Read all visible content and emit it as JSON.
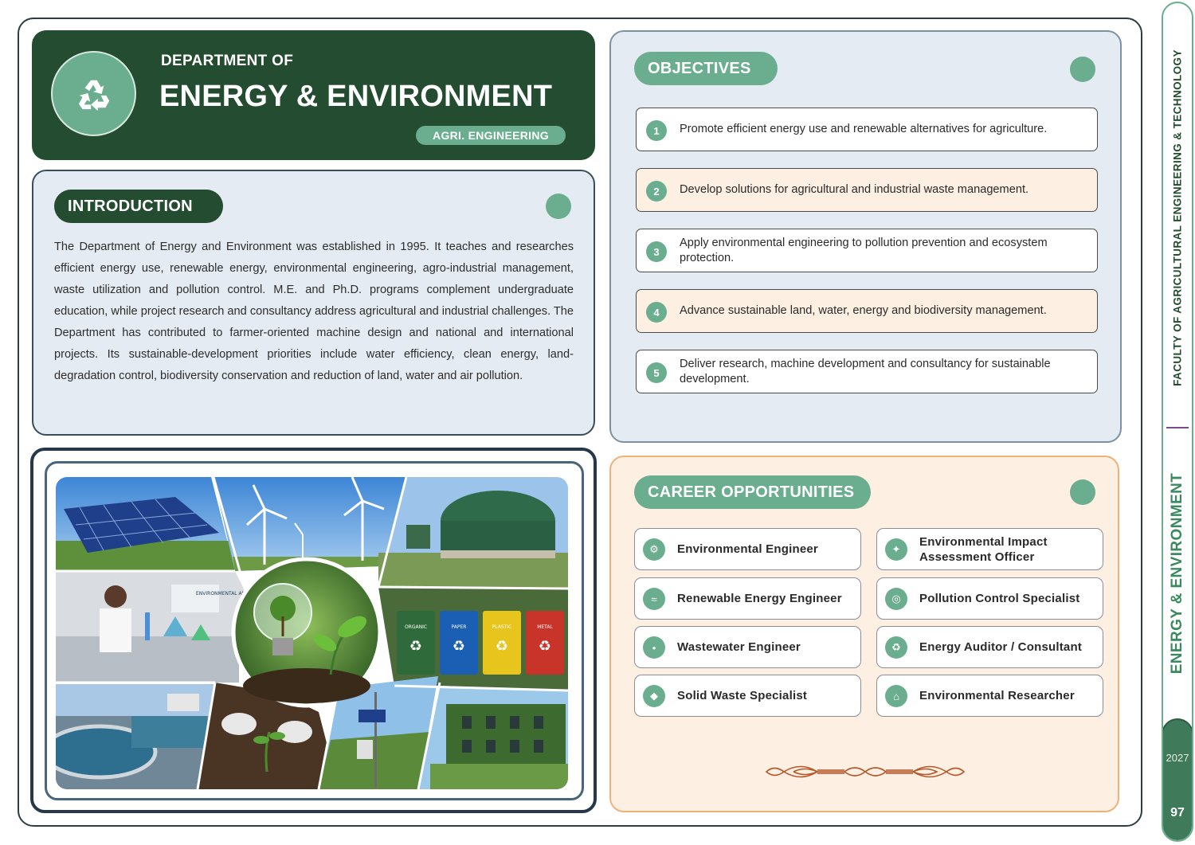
{
  "header": {
    "eyebrow": "DEPARTMENT OF",
    "title": "ENERGY & ENVIRONMENT",
    "badge": "AGRI. ENGINEERING",
    "logo_icon": "recycle-icon"
  },
  "introduction": {
    "heading": "INTRODUCTION",
    "body": "The Department of Energy and Environment was established in 1995. It teaches and researches efficient energy use, renewable energy, environmental engineering, agro-industrial management, waste utilization and pollution control. M.E. and Ph.D. programs complement undergraduate education, while project research and consultancy address agricultural and industrial challenges. The Department has contributed to farmer-oriented machine design and national and international projects. Its sustainable-development priorities include water efficiency, clean energy, land-degradation control, biodiversity conservation and reduction of land, water and air pollution."
  },
  "objectives": {
    "heading": "OBJECTIVES",
    "items": [
      {
        "num": "1",
        "text": "Promote efficient energy use and renewable alternatives for agriculture."
      },
      {
        "num": "2",
        "text": "Develop solutions for agricultural and industrial waste management."
      },
      {
        "num": "3",
        "text": "Apply environmental engineering to pollution prevention and ecosystem protection."
      },
      {
        "num": "4",
        "text": "Advance sustainable land, water, energy and biodiversity management."
      },
      {
        "num": "5",
        "text": "Deliver research, machine development and consultancy for sustainable development."
      }
    ]
  },
  "careers": {
    "heading": "CAREER OPPORTUNITIES",
    "items": [
      {
        "label": "Environmental Engineer",
        "icon": "gear-icon"
      },
      {
        "label": "Environmental Impact Assessment Officer",
        "icon": "sparkle-icon"
      },
      {
        "label": "Renewable Energy Engineer",
        "icon": "wave-icon"
      },
      {
        "label": "Pollution Control Specialist",
        "icon": "target-icon"
      },
      {
        "label": "Wastewater Engineer",
        "icon": "droplet-icon"
      },
      {
        "label": "Energy Auditor / Consultant",
        "icon": "recycle-icon"
      },
      {
        "label": "Solid Waste Specialist",
        "icon": "diamond-icon"
      },
      {
        "label": "Environmental Researcher",
        "icon": "home-icon"
      }
    ]
  },
  "photo_collage": {
    "bin_labels": [
      "ORGANIC",
      "PAPER",
      "PLASTIC",
      "METAL"
    ],
    "board_text": "ENVIRONMENTAL ANALYSIS"
  },
  "side_rail": {
    "faculty": "FACULTY OF AGRICULTURAL  ENGINEERING & TECHNOLOGY",
    "department": "ENERGY & ENVIRONMENT",
    "year": "2027",
    "page": "97"
  },
  "colors": {
    "dark_green": "#234c30",
    "accent_green": "#6aae8f",
    "panel_blue": "#e4ebf2",
    "panel_peach": "#fdf0e2",
    "ornament_brown": "#b5582a"
  }
}
